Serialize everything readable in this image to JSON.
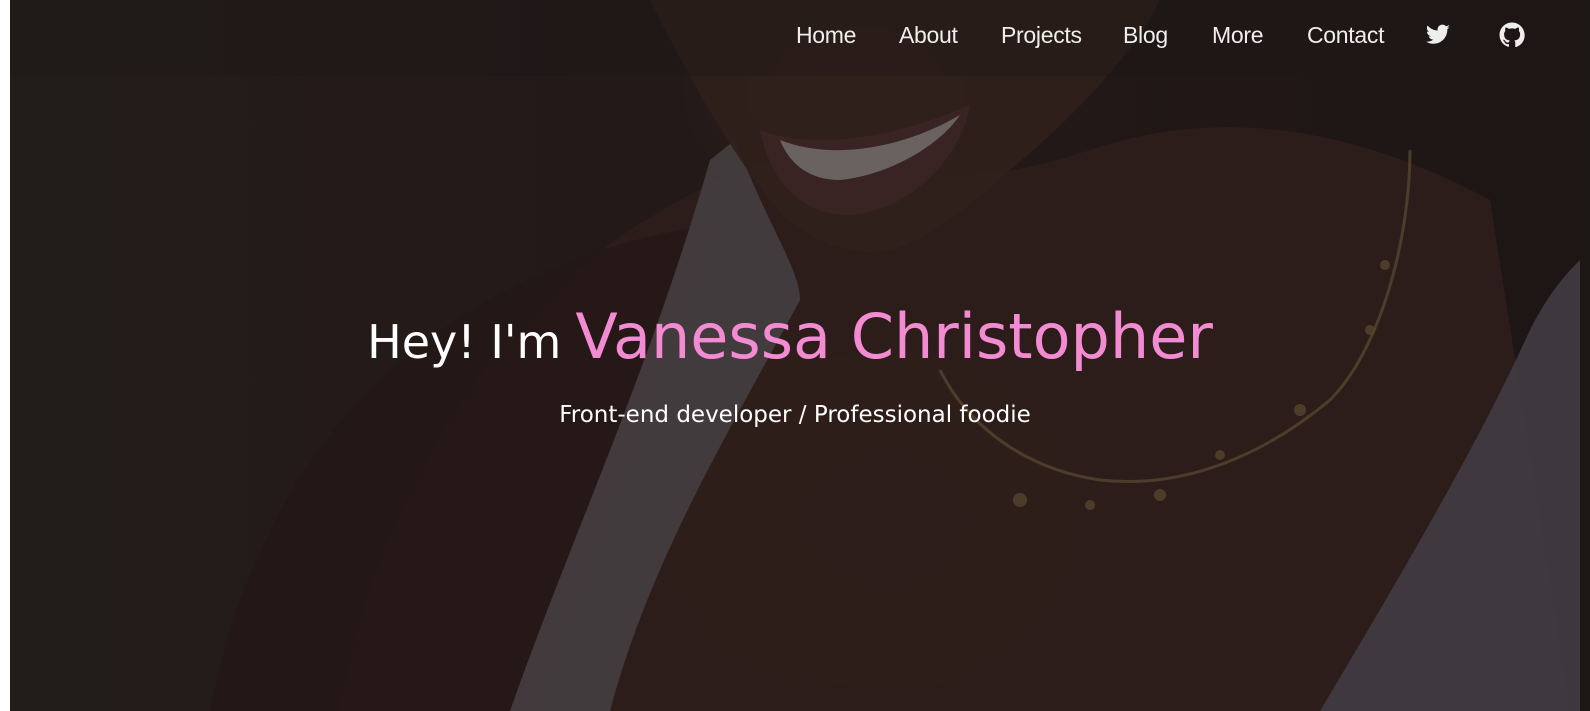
{
  "nav": {
    "links": [
      "Home",
      "About",
      "Projects",
      "Blog",
      "More",
      "Contact"
    ],
    "icons": [
      "twitter-icon",
      "github-icon"
    ]
  },
  "hero": {
    "greeting": "Hey! I'm",
    "name": "Vanessa Christopher",
    "subtitle": "Front-end developer / Professional foodie"
  },
  "colors": {
    "accent": "#f38bd3",
    "text": "#ffffff",
    "nav_text": "#eeeeee",
    "background": "#2a2220"
  }
}
